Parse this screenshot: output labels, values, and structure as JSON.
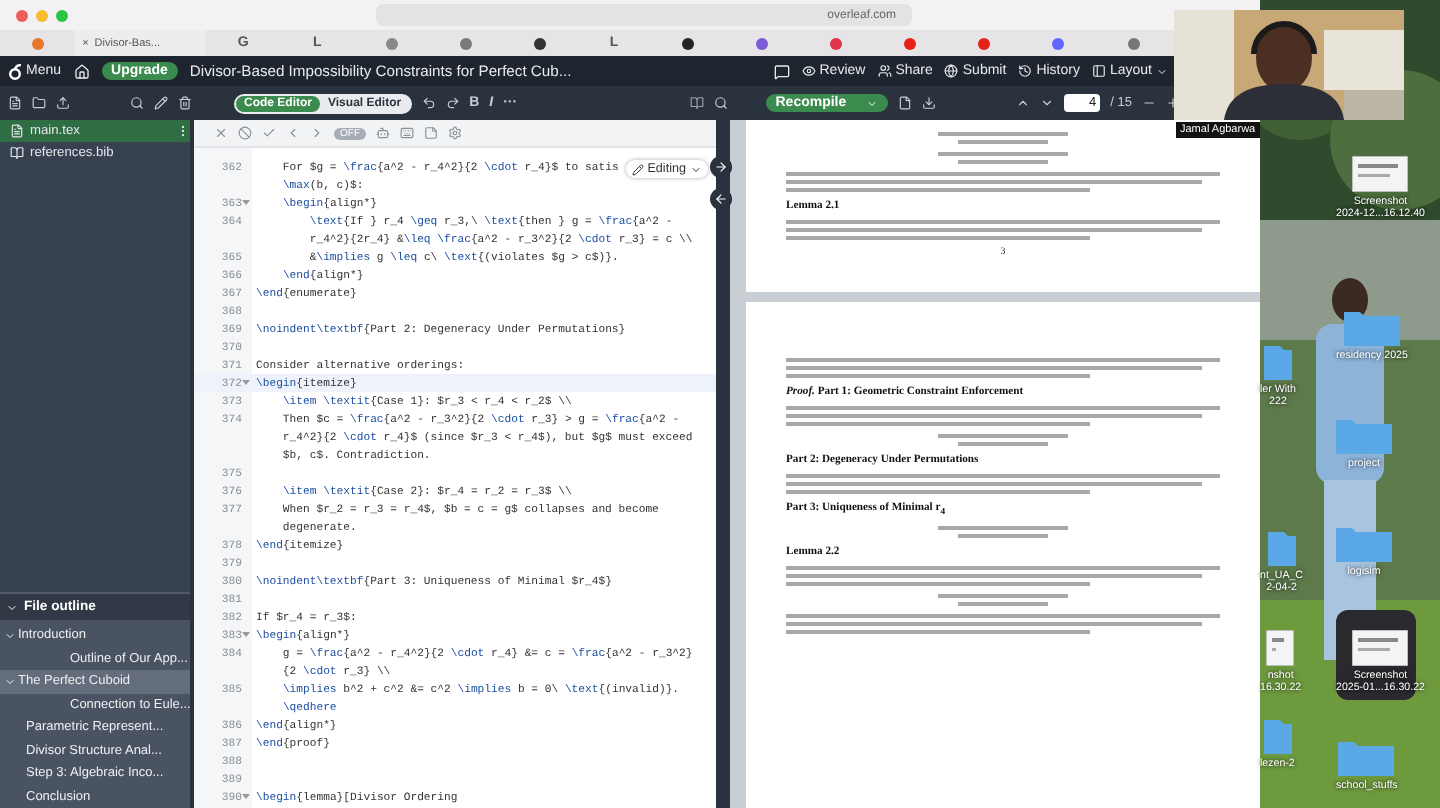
{
  "browser": {
    "address": "overleaf.com",
    "tabs": [
      {
        "kind": "dot",
        "color": "#e8772e"
      },
      {
        "kind": "page",
        "label": "Divisor-Bas...",
        "close": "×"
      },
      {
        "kind": "letter",
        "text": "G"
      },
      {
        "kind": "letter",
        "text": "L"
      },
      {
        "kind": "dot",
        "color": "#8a8a8a"
      },
      {
        "kind": "dot",
        "color": "#7a7a7a"
      },
      {
        "kind": "dot",
        "color": "#333333"
      },
      {
        "kind": "letter",
        "text": "L"
      },
      {
        "kind": "dot",
        "color": "#222222"
      },
      {
        "kind": "dot",
        "color": "#7b5cd6"
      },
      {
        "kind": "dot",
        "color": "#e0344a"
      },
      {
        "kind": "dot",
        "color": "#e62117"
      },
      {
        "kind": "dot",
        "color": "#e62117"
      },
      {
        "kind": "dot",
        "color": "#6364ff"
      },
      {
        "kind": "dot",
        "color": "#777777"
      }
    ]
  },
  "header": {
    "menu": "Menu",
    "upgrade": "Upgrade",
    "title": "Divisor-Based Impossibility Constraints for Perfect Cub...",
    "actions": [
      {
        "kind": "review",
        "label": "Review"
      },
      {
        "kind": "share",
        "label": "Share"
      },
      {
        "kind": "submit",
        "label": "Submit"
      },
      {
        "kind": "history",
        "label": "History"
      },
      {
        "kind": "layout",
        "label": "Layout"
      }
    ]
  },
  "toolbar": {
    "editor_modes": [
      {
        "label": "Code Editor",
        "selected": true
      },
      {
        "label": "Visual Editor",
        "selected": false
      }
    ],
    "format": [
      "B",
      "I",
      "···"
    ],
    "recompile": "Recompile",
    "page": "4",
    "page_total": "/ 15"
  },
  "files": [
    {
      "name": "main.tex",
      "kind": "tex",
      "selected": true
    },
    {
      "name": "references.bib",
      "kind": "bib",
      "selected": false
    }
  ],
  "outline": {
    "title": "File outline",
    "expanded": true,
    "items": [
      {
        "label": "Introduction",
        "selected": false,
        "expanded": true,
        "children": [
          {
            "label": "Outline of Our App...",
            "selected": false
          }
        ]
      },
      {
        "label": "The Perfect Cuboid",
        "selected": true,
        "expanded": true,
        "children": [
          {
            "label": "Connection to Eule...",
            "selected": false
          }
        ]
      },
      {
        "label": "Parametric Represent...",
        "selected": false
      },
      {
        "label": "Divisor Structure Anal...",
        "selected": false
      },
      {
        "label": "Step 3: Algebraic Inco...",
        "selected": false
      },
      {
        "label": "Conclusion",
        "selected": false
      }
    ]
  },
  "editor": {
    "toggle": "OFF",
    "mode": "Editing",
    "lines": [
      {
        "number": "362",
        "fold": false,
        "current": false,
        "text": [
          "    For $g = \\frac{a^2 - r_4^2}{2 \\cdot r_4}$ to satis",
          "    \\max(b, c)$:"
        ]
      },
      {
        "number": "363",
        "fold": true,
        "current": false,
        "text": [
          "    \\begin{align*}"
        ]
      },
      {
        "number": "364",
        "fold": false,
        "current": false,
        "text": [
          "        \\text{If } r_4 \\geq r_3,\\ \\text{then } g = \\frac{a^2 -",
          "        r_4^2}{2r_4} &\\leq \\frac{a^2 - r_3^2}{2 \\cdot r_3} = c \\\\"
        ]
      },
      {
        "number": "365",
        "fold": false,
        "current": false,
        "text": [
          "        &\\implies g \\leq c\\ \\text{(violates $g > c$)}."
        ]
      },
      {
        "number": "366",
        "fold": false,
        "current": false,
        "text": [
          "    \\end{align*}"
        ]
      },
      {
        "number": "367",
        "fold": false,
        "current": false,
        "text": [
          "\\end{enumerate}"
        ]
      },
      {
        "number": "368",
        "fold": false,
        "current": false
      },
      {
        "number": "369",
        "fold": false,
        "current": false,
        "text": [
          "\\noindent\\textbf{Part 2: Degeneracy Under Permutations}"
        ]
      },
      {
        "number": "370",
        "fold": false,
        "current": false
      },
      {
        "number": "371",
        "fold": false,
        "current": false,
        "text": [
          "Consider alternative orderings:"
        ]
      },
      {
        "number": "372",
        "fold": true,
        "current": true,
        "text": [
          "\\begin{itemize}"
        ]
      },
      {
        "number": "373",
        "fold": false,
        "current": false,
        "text": [
          "    \\item \\textit{Case 1}: $r_3 < r_4 < r_2$ \\\\"
        ]
      },
      {
        "number": "374",
        "fold": false,
        "current": false,
        "text": [
          "    Then $c = \\frac{a^2 - r_3^2}{2 \\cdot r_3} > g = \\frac{a^2 -",
          "    r_4^2}{2 \\cdot r_4}$ (since $r_3 < r_4$), but $g$ must exceed",
          "    $b, c$. Contradiction."
        ]
      },
      {
        "number": "375",
        "fold": false,
        "current": false
      },
      {
        "number": "376",
        "fold": false,
        "current": false,
        "text": [
          "    \\item \\textit{Case 2}: $r_4 = r_2 = r_3$ \\\\"
        ]
      },
      {
        "number": "377",
        "fold": false,
        "current": false,
        "text": [
          "    When $r_2 = r_3 = r_4$, $b = c = g$ collapses and become",
          "    degenerate."
        ]
      },
      {
        "number": "378",
        "fold": false,
        "current": false,
        "text": [
          "\\end{itemize}"
        ]
      },
      {
        "number": "379",
        "fold": false,
        "current": false
      },
      {
        "number": "380",
        "fold": false,
        "current": false,
        "text": [
          "\\noindent\\textbf{Part 3: Uniqueness of Minimal $r_4$}"
        ]
      },
      {
        "number": "381",
        "fold": false,
        "current": false
      },
      {
        "number": "382",
        "fold": false,
        "current": false,
        "text": [
          "If $r_4 = r_3$:"
        ]
      },
      {
        "number": "383",
        "fold": true,
        "current": false,
        "text": [
          "\\begin{align*}"
        ]
      },
      {
        "number": "384",
        "fold": false,
        "current": false,
        "text": [
          "    g = \\frac{a^2 - r_4^2}{2 \\cdot r_4} &= c = \\frac{a^2 - r_3^2}",
          "    {2 \\cdot r_3} \\\\"
        ]
      },
      {
        "number": "385",
        "fold": false,
        "current": false,
        "text": [
          "    \\implies b^2 + c^2 &= c^2 \\implies b = 0\\ \\text{(invalid)}.",
          "    \\qedhere"
        ]
      },
      {
        "number": "386",
        "fold": false,
        "current": false,
        "text": [
          "\\end{align*}"
        ]
      },
      {
        "number": "387",
        "fold": false,
        "current": false,
        "text": [
          "\\end{proof}"
        ]
      },
      {
        "number": "388",
        "fold": false,
        "current": false
      },
      {
        "number": "389",
        "fold": false,
        "current": false
      },
      {
        "number": "390",
        "fold": true,
        "current": false,
        "text": [
          "\\begin{lemma}[Divisor Ordering"
        ]
      }
    ]
  },
  "pdf": {
    "pages": [
      {
        "items": [
          {
            "kind": "formula"
          },
          {
            "kind": "formula"
          },
          {
            "kind": "paragraph"
          },
          {
            "kind": "heading",
            "text": "Lemma 2.1"
          },
          {
            "kind": "paragraph"
          },
          {
            "kind": "page-number",
            "text": "3"
          }
        ]
      },
      {
        "items": [
          {
            "kind": "paragraph"
          },
          {
            "kind": "heading",
            "text": "*Proof.* Part 1: Geometric Constraint Enforcement"
          },
          {
            "kind": "paragraph"
          },
          {
            "kind": "formula"
          },
          {
            "kind": "heading",
            "text": "Part 2: Degeneracy Under Permutations"
          },
          {
            "kind": "paragraph"
          },
          {
            "kind": "heading",
            "text": "Part 3: Uniqueness of Minimal r$_{4}$"
          },
          {
            "kind": "formula"
          },
          {
            "kind": "heading",
            "text": "Lemma 2.2"
          },
          {
            "kind": "paragraph"
          },
          {
            "kind": "formula"
          },
          {
            "kind": "paragraph"
          }
        ]
      }
    ]
  },
  "webcam": {
    "name": "Jamal Agbarwa"
  },
  "desktop": {
    "icons": [
      {
        "kind": "screenshot",
        "label": [
          "Screenshot",
          "2024-12...16.12.40"
        ]
      },
      {
        "kind": "folder",
        "label": [
          "residency 2025"
        ]
      },
      {
        "kind": "folder",
        "label": [
          "ler With",
          "222"
        ]
      },
      {
        "kind": "folder",
        "label": [
          "project"
        ]
      },
      {
        "kind": "folder",
        "label": [
          "nt_UA_C",
          "2-04-2"
        ]
      },
      {
        "kind": "folder",
        "label": [
          "logisim"
        ]
      },
      {
        "kind": "screenshot",
        "label": [
          "nshot",
          "16.30.22"
        ]
      },
      {
        "kind": "screenshot",
        "label": [
          "Screenshot",
          "2025-01...16.30.22"
        ]
      },
      {
        "kind": "folder",
        "label": [
          "lezen-2"
        ]
      },
      {
        "kind": "folder",
        "label": [
          "school_stuffs"
        ]
      }
    ]
  }
}
